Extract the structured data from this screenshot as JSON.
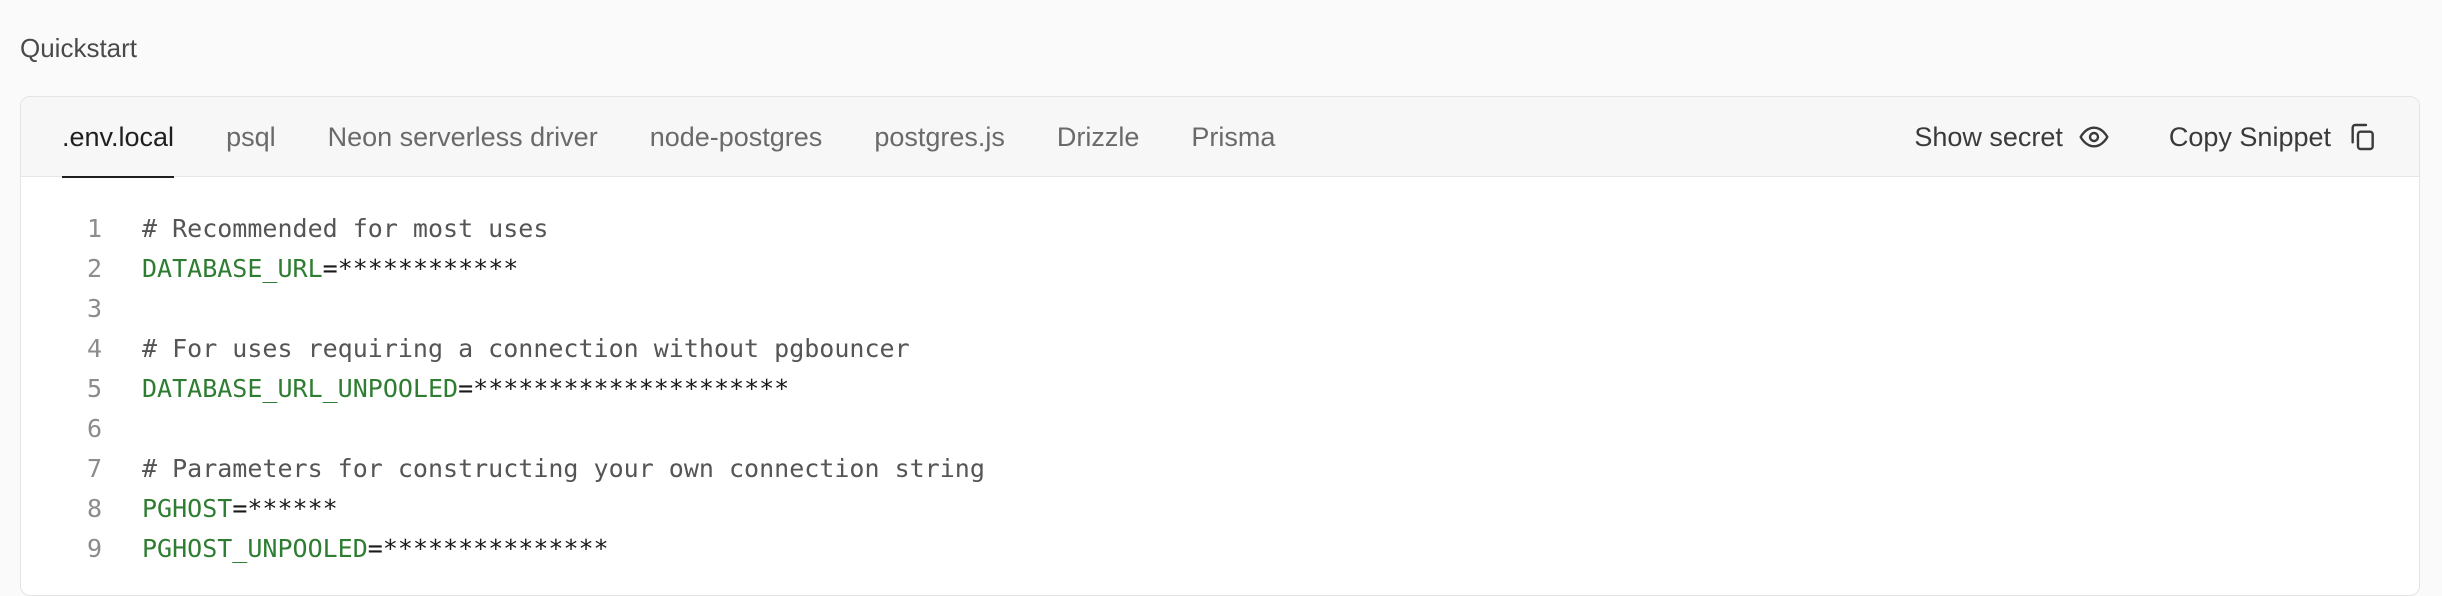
{
  "section_title": "Quickstart",
  "tabs": [
    {
      "label": ".env.local",
      "active": true
    },
    {
      "label": "psql",
      "active": false
    },
    {
      "label": "Neon serverless driver",
      "active": false
    },
    {
      "label": "node-postgres",
      "active": false
    },
    {
      "label": "postgres.js",
      "active": false
    },
    {
      "label": "Drizzle",
      "active": false
    },
    {
      "label": "Prisma",
      "active": false
    }
  ],
  "actions": {
    "show_secret": {
      "label": "Show secret",
      "icon": "eye-icon"
    },
    "copy_snippet": {
      "label": "Copy Snippet",
      "icon": "copy-icon"
    }
  },
  "code_lines": [
    {
      "n": "1",
      "comment": "# Recommended for most uses",
      "key": "",
      "eq": "",
      "value": ""
    },
    {
      "n": "2",
      "comment": "",
      "key": "DATABASE_URL",
      "eq": "=",
      "value": "************"
    },
    {
      "n": "3",
      "comment": "",
      "key": "",
      "eq": "",
      "value": ""
    },
    {
      "n": "4",
      "comment": "# For uses requiring a connection without pgbouncer",
      "key": "",
      "eq": "",
      "value": ""
    },
    {
      "n": "5",
      "comment": "",
      "key": "DATABASE_URL_UNPOOLED",
      "eq": "=",
      "value": "*********************"
    },
    {
      "n": "6",
      "comment": "",
      "key": "",
      "eq": "",
      "value": ""
    },
    {
      "n": "7",
      "comment": "# Parameters for constructing your own connection string",
      "key": "",
      "eq": "",
      "value": ""
    },
    {
      "n": "8",
      "comment": "",
      "key": "PGHOST",
      "eq": "=",
      "value": "******"
    },
    {
      "n": "9",
      "comment": "",
      "key": "PGHOST_UNPOOLED",
      "eq": "=",
      "value": "***************"
    }
  ],
  "colors": {
    "key": "#2e7d32",
    "comment": "#555555",
    "line_number": "#8c8c8c"
  }
}
